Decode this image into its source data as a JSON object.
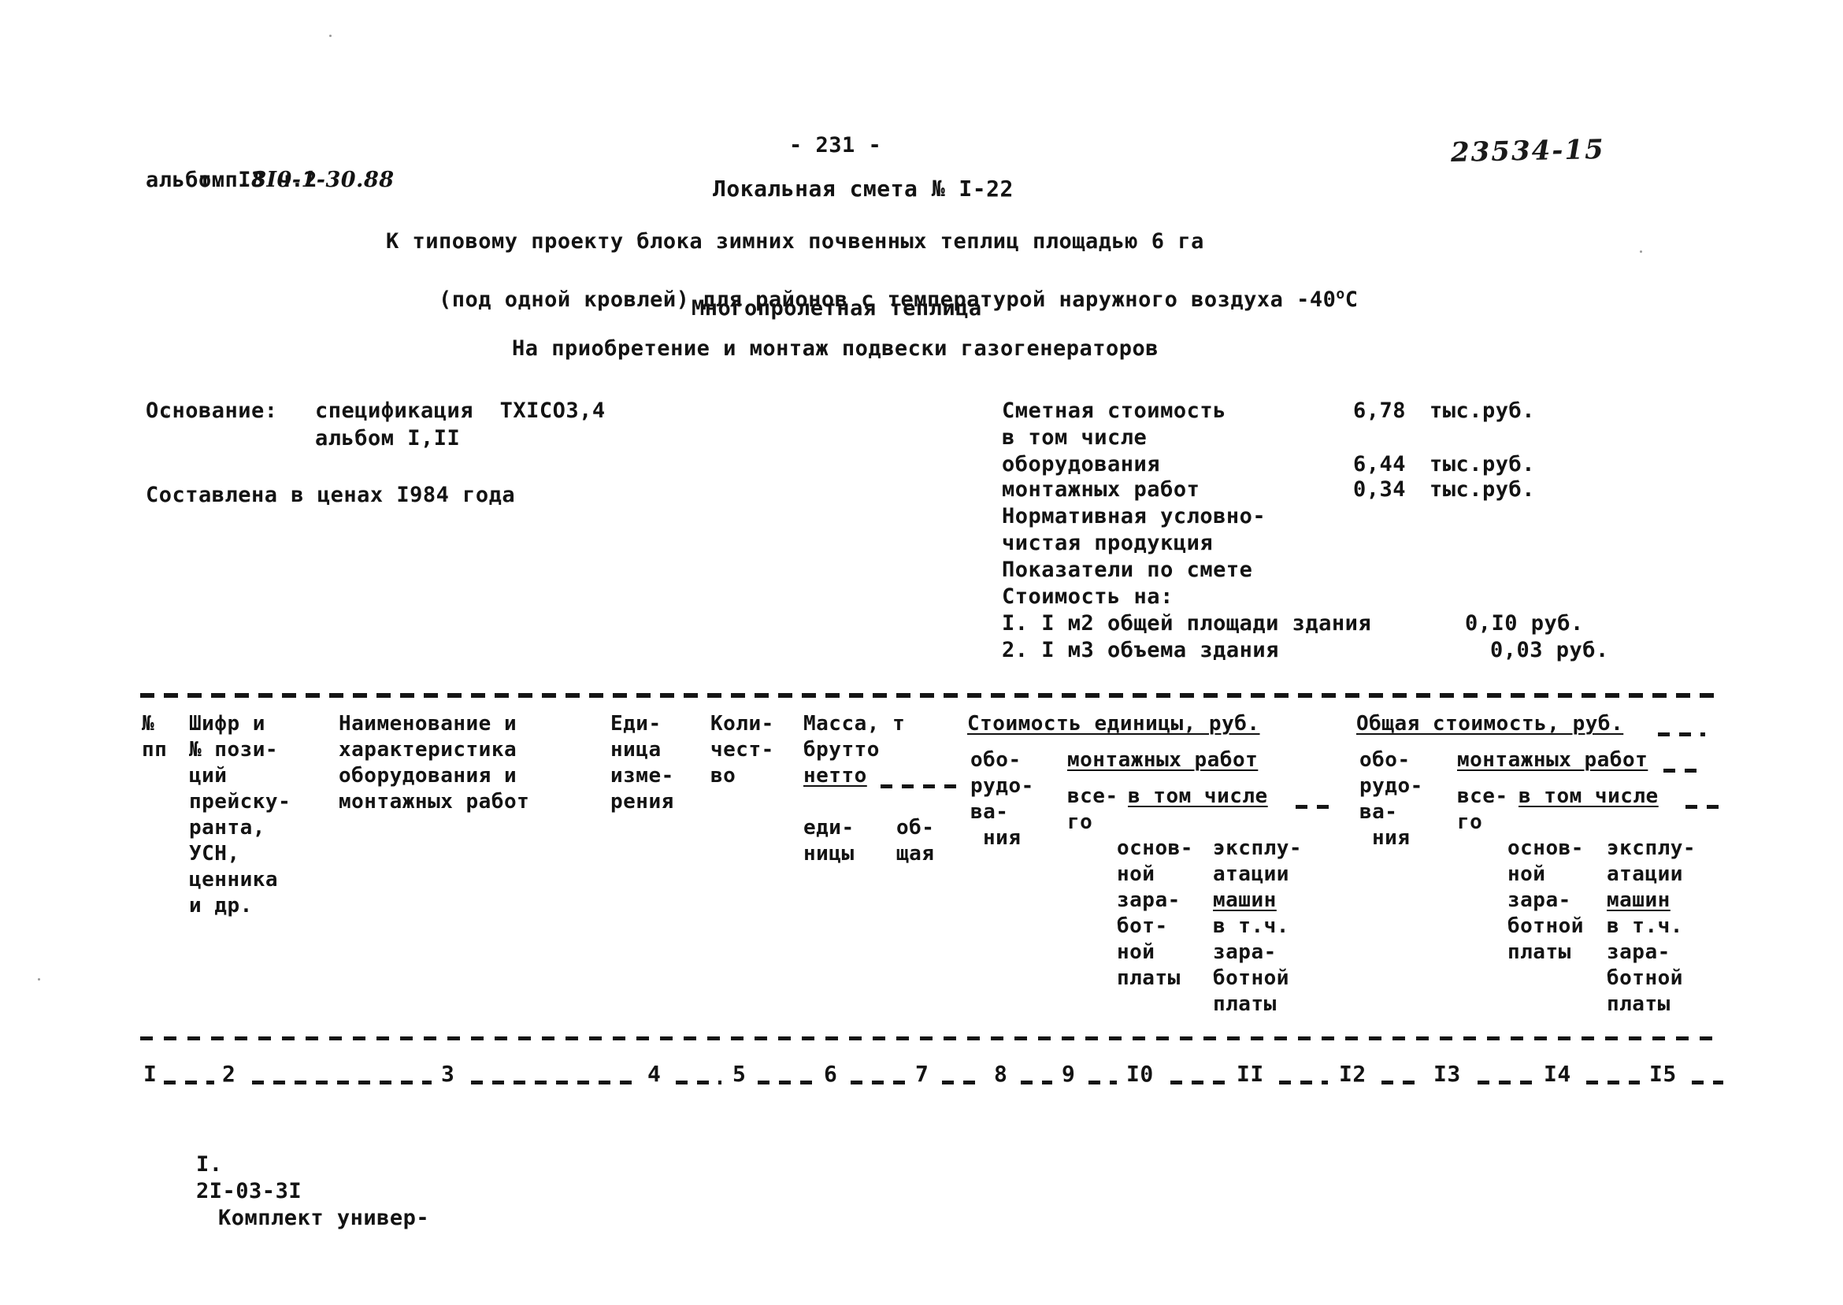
{
  "document": {
    "project_code_label": "т.п.",
    "project_code": "8I0-1-30.88",
    "album_line": "альбом I3 ч.2",
    "page_number": "- 231 -",
    "archive_number": "23534-15",
    "estimate_title": "Локальная смета № I-22",
    "description_line1": "К типовому проекту блока зимних почвенных теплиц площадью 6 га",
    "description_line2_pre": "(под одной кровлей) для районов с температурой наружного воздуха -40",
    "description_line2_sup": "o",
    "description_line2_post": "С",
    "greenhouse_type": "Многопролетная теплица",
    "subject": "На приобретение и монтаж подвески газогенераторов"
  },
  "basis": {
    "label": "Основание:",
    "spec_line": "спецификация  ТХIСО3,4",
    "album_line": "альбом I,II",
    "prices_line": "Составлена в ценах I984 года"
  },
  "summary": {
    "rows": [
      {
        "label": "Сметная стоимость",
        "value": "6,78",
        "unit": "тыс.руб."
      },
      {
        "label": "в том числе",
        "value": "",
        "unit": ""
      },
      {
        "label": "оборудования",
        "value": "6,44",
        "unit": "тыс.руб."
      },
      {
        "label": "монтажных работ",
        "value": "0,34",
        "unit": "тыс.руб."
      },
      {
        "label": "Нормативная условно-",
        "value": "",
        "unit": ""
      },
      {
        "label": "чистая продукция",
        "value": "",
        "unit": ""
      },
      {
        "label": "Показатели по смете",
        "value": "",
        "unit": ""
      },
      {
        "label": "Стоимость на:",
        "value": "",
        "unit": ""
      }
    ],
    "indicators": [
      {
        "label": "I. I м2 общей площади здания",
        "value": "0,I0 руб."
      },
      {
        "label": "2. I м3 объема здания",
        "value": "0,03 руб."
      }
    ]
  },
  "table": {
    "headers": {
      "col1": [
        "№",
        "пп"
      ],
      "col2": [
        "Шифр и",
        "№ пози-",
        "ций",
        "прейску-",
        "ранта,",
        "УСН,",
        "ценника",
        "и др."
      ],
      "col3": [
        "Наименование и",
        "характеристика",
        "оборудования и",
        "монтажных работ"
      ],
      "col4": [
        "Еди-",
        "ница",
        "изме-",
        "рения"
      ],
      "col5": [
        "Коли-",
        "чест-",
        "во"
      ],
      "col6_group": "Масса, т",
      "col6_brutto": "брутто",
      "col6_netto": "нетто",
      "col6_unit": [
        "еди-",
        "ницы"
      ],
      "col7_total": [
        "об-",
        "щая"
      ],
      "unit_cost_group": "Стоимость единицы, руб.",
      "total_cost_group": "Общая стоимость, руб.",
      "equipment": [
        "обо-",
        "рудо-",
        "ва-",
        "ния"
      ],
      "install_group": "монтажных работ",
      "all_in": [
        "все-",
        "го"
      ],
      "including": "в том числе",
      "basic_wage": [
        "основ-",
        "ной",
        "зара-",
        "бот-",
        "ной",
        "платы"
      ],
      "basic_wage_alt": [
        "основ-",
        "ной",
        "зара-",
        "ботной",
        "платы"
      ],
      "machine_op": [
        "эксплу-",
        "атации",
        "машин"
      ],
      "machine_op_sub": [
        "в т.ч.",
        "зара-",
        "ботной",
        "платы"
      ]
    },
    "column_numbers": [
      "I",
      "2",
      "3",
      "4",
      "5",
      "6",
      "7",
      "8",
      "9",
      "I0",
      "II",
      "I2",
      "I3",
      "I4",
      "I5"
    ],
    "rows": [
      {
        "num": "I.",
        "code": "2I-03-3I",
        "name": "Комплект универ-"
      }
    ]
  }
}
